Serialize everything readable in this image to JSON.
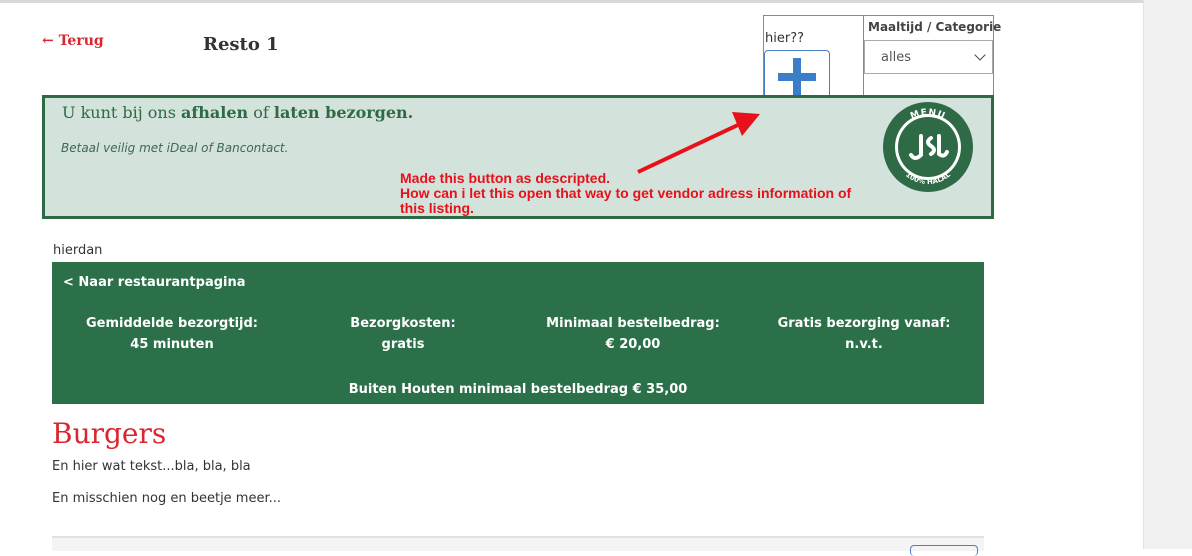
{
  "header": {
    "back_label": "← Terug",
    "title": "Resto 1"
  },
  "hier_widget": {
    "label": "hier??",
    "button_icon": "plus-icon",
    "accent": "#3a7ec8"
  },
  "category_filter": {
    "label": "Maaltijd / Categorie",
    "selected": "alles"
  },
  "banner": {
    "headline_prefix": "U kunt bij ons ",
    "headline_bold1": "afhalen",
    "headline_mid": " of ",
    "headline_bold2": "laten bezorgen.",
    "subtext": "Betaal veilig met iDeal of Bancontact.",
    "badge_top": "MENU",
    "badge_bottom": "100% HALAL",
    "badge_color": "#2d6a45"
  },
  "annotation": {
    "line1": "Made this button as descripted.",
    "line2": "How can i let this open that way to get vendor adress information of",
    "line3": "this listing.",
    "color": "#e8101b"
  },
  "hierdan": "hierdan",
  "info_panel": {
    "back_label": "< Naar restaurantpagina",
    "stats": [
      {
        "label": "Gemiddelde bezorgtijd:",
        "value": "45 minuten"
      },
      {
        "label": "Bezorgkosten:",
        "value": "gratis"
      },
      {
        "label": "Minimaal bestelbedrag:",
        "value": "€ 20,00"
      },
      {
        "label": "Gratis bezorging vanaf:",
        "value": "n.v.t."
      }
    ],
    "note": "Buiten Houten minimaal bestelbedrag € 35,00",
    "bg": "#2b7048"
  },
  "category": {
    "heading": "Burgers",
    "text1": "En hier wat tekst...bla, bla, bla",
    "text2": "En misschien nog en beetje meer..."
  }
}
